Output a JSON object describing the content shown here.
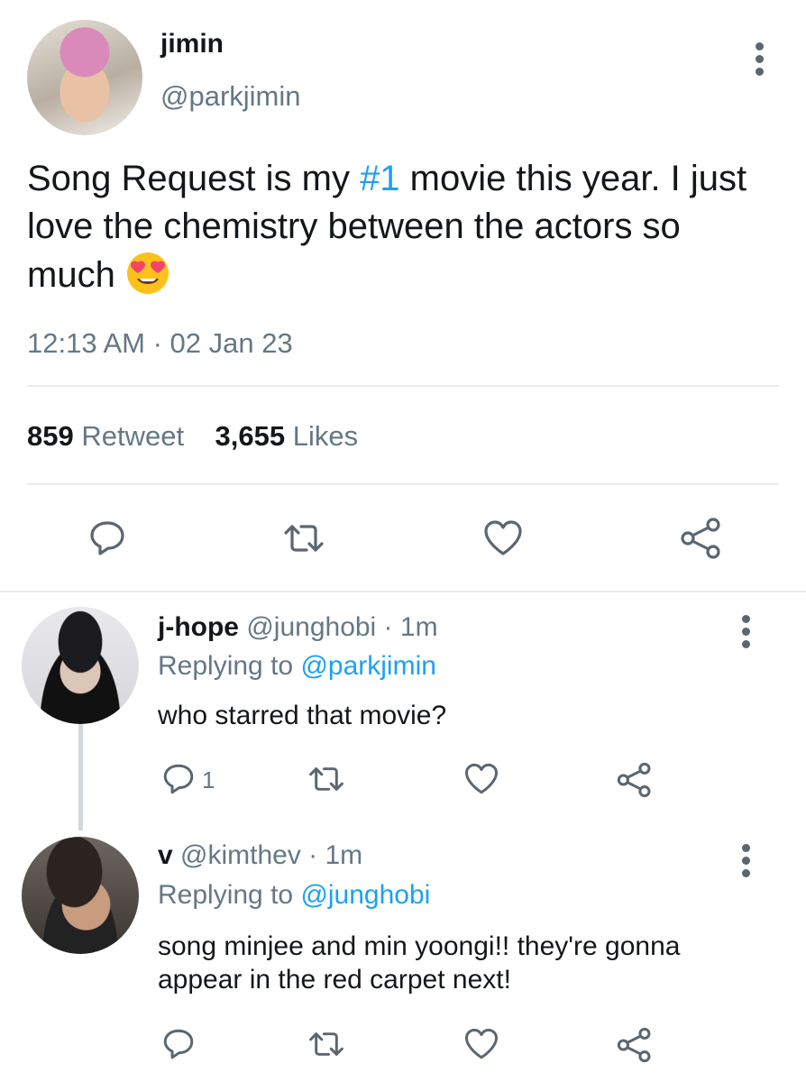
{
  "main_tweet": {
    "display_name": "jimin",
    "handle": "@parkjimin",
    "text_before": "Song Request is my ",
    "hashtag": "#1",
    "text_after": " movie this year. I just love the chemistry between the actors so much",
    "emoji_icon": "smiling-face-with-heart-eyes",
    "timestamp": "12:13 AM · 02 Jan 23",
    "retweet_count": "859",
    "retweet_label": "Retweet",
    "likes_count": "3,655",
    "likes_label": "Likes",
    "actions": [
      "reply-icon",
      "retweet-icon",
      "like-icon",
      "share-icon"
    ]
  },
  "replies": [
    {
      "name": "j-hope",
      "handle_time": " @junghobi · 1m",
      "replying_prefix": "Replying to ",
      "replying_to": "@parkjimin",
      "text": "who starred that movie?",
      "reply_count": "1"
    },
    {
      "name": "v",
      "handle_time": " @kimthev · 1m",
      "replying_prefix": "Replying to ",
      "replying_to": "@junghobi",
      "text": "song minjee and min yoongi!! they're gonna appear in the red carpet next!",
      "reply_count": ""
    }
  ],
  "colors": {
    "accent": "#1da1f2",
    "secondary_text": "#657786",
    "icon": "#5b6670",
    "divider": "#e6ecf0",
    "emoji_face": "#fcc21b",
    "emoji_hearts": "#f4436c"
  }
}
